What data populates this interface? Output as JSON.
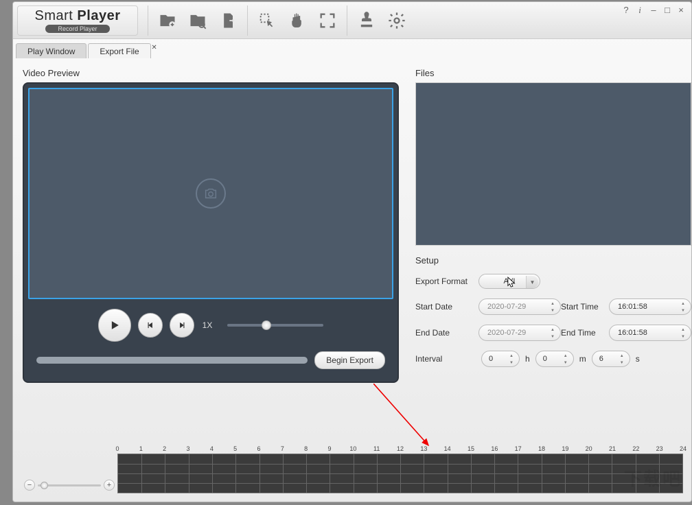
{
  "brand": {
    "thin": "Smart",
    "bold": "Player",
    "sub": "Record Player"
  },
  "tabs": {
    "playWindow": "Play Window",
    "exportFile": "Export File"
  },
  "left": {
    "header": "Video Preview",
    "speed": "1X",
    "beginExport": "Begin Export"
  },
  "right": {
    "filesHeader": "Files",
    "setupHeader": "Setup"
  },
  "form": {
    "exportFormatLabel": "Export Format",
    "exportFormat": "AVI",
    "startDateLabel": "Start Date",
    "startDate": "2020-07-29",
    "startTimeLabel": "Start Time",
    "startTime": "16:01:58",
    "endDateLabel": "End Date",
    "endDate": "2020-07-29",
    "endTimeLabel": "End Time",
    "endTime": "16:01:58",
    "intervalLabel": "Interval",
    "h": "0",
    "hUnit": "h",
    "m": "0",
    "mUnit": "m",
    "s": "6",
    "sUnit": "s"
  },
  "timeline": {
    "labels": [
      "0",
      "1",
      "2",
      "3",
      "4",
      "5",
      "6",
      "7",
      "8",
      "9",
      "10",
      "11",
      "12",
      "13",
      "14",
      "15",
      "16",
      "17",
      "18",
      "19",
      "20",
      "21",
      "22",
      "23",
      "24"
    ]
  },
  "wc": {
    "help": "?",
    "info": "i",
    "min": "–",
    "max": "□",
    "close": "×"
  }
}
